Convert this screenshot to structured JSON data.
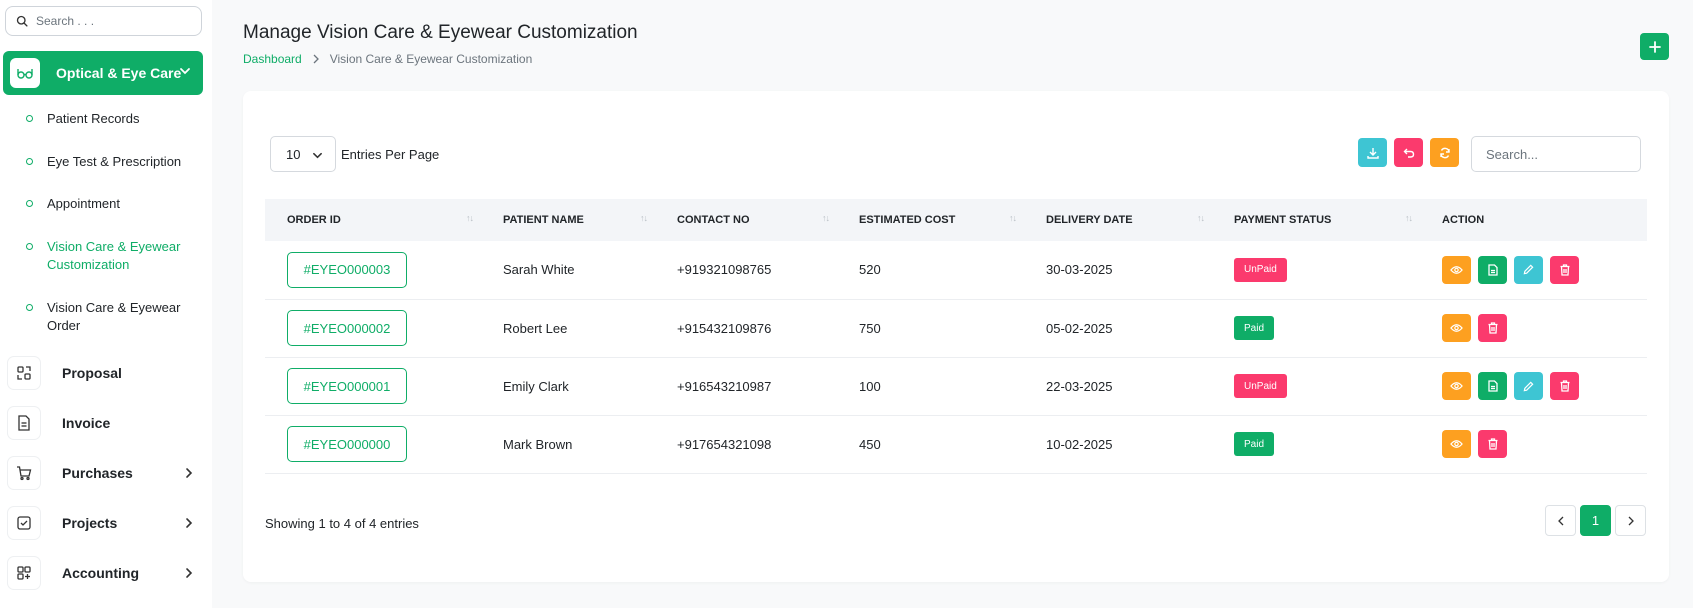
{
  "sidebar": {
    "search_placeholder": "Search . . .",
    "active": {
      "label": "Optical & Eye Care",
      "icon": "glasses-icon"
    },
    "subitems": [
      {
        "label": "Patient Records"
      },
      {
        "label": "Eye Test & Prescription"
      },
      {
        "label": "Appointment"
      },
      {
        "label": "Vision Care & Eyewear Customization"
      },
      {
        "label": "Vision Care & Eyewear Order"
      }
    ],
    "items": [
      {
        "label": "Proposal",
        "icon": "proposal-icon"
      },
      {
        "label": "Invoice",
        "icon": "invoice-icon"
      },
      {
        "label": "Purchases",
        "icon": "cart-icon"
      },
      {
        "label": "Projects",
        "icon": "checkbox-icon"
      },
      {
        "label": "Accounting",
        "icon": "grid-icon"
      }
    ]
  },
  "header": {
    "title": "Manage Vision Care & Eyewear Customization",
    "breadcrumb": {
      "home": "Dashboard",
      "current": "Vision Care & Eyewear Customization"
    }
  },
  "toolbar": {
    "entries_value": "10",
    "entries_label": "Entries Per Page",
    "search_placeholder": "Search..."
  },
  "table": {
    "columns": [
      "ORDER ID",
      "PATIENT NAME",
      "CONTACT NO",
      "ESTIMATED COST",
      "DELIVERY DATE",
      "PAYMENT STATUS",
      "ACTION"
    ],
    "rows": [
      {
        "order_id": "#EYEO000003",
        "patient": "Sarah White",
        "contact": "+919321098765",
        "cost": "520",
        "date": "30-03-2025",
        "status": "UnPaid"
      },
      {
        "order_id": "#EYEO000002",
        "patient": "Robert Lee",
        "contact": "+915432109876",
        "cost": "750",
        "date": "05-02-2025",
        "status": "Paid"
      },
      {
        "order_id": "#EYEO000001",
        "patient": "Emily Clark",
        "contact": "+916543210987",
        "cost": "100",
        "date": "22-03-2025",
        "status": "UnPaid"
      },
      {
        "order_id": "#EYEO000000",
        "patient": "Mark Brown",
        "contact": "+917654321098",
        "cost": "450",
        "date": "10-02-2025",
        "status": "Paid"
      }
    ]
  },
  "footer": {
    "showing": "Showing 1 to 4 of 4 entries",
    "current_page": "1"
  },
  "colors": {
    "accent": "#0fad67",
    "danger": "#fb3a6d",
    "warning": "#fda020",
    "info": "#3ec5d3"
  }
}
